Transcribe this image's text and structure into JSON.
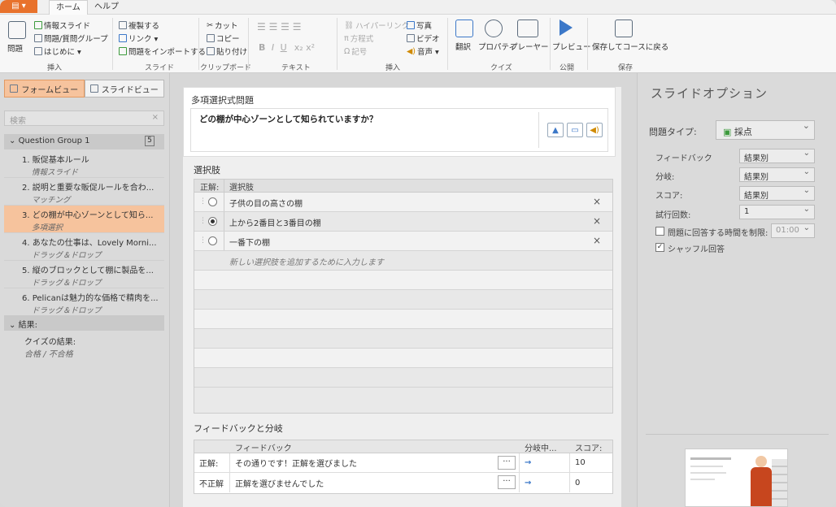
{
  "tabs": {
    "file": "▤ ▾",
    "home": "ホーム",
    "help": "ヘルプ"
  },
  "ribbon": {
    "question": "問題",
    "info_slide": "情報スライド",
    "question_group": "問題/質問グループ",
    "intro": "はじめに ▾",
    "duplicate": "複製する",
    "link": "リンク ▾",
    "import_questions": "問題をインポートする",
    "cut": "カット",
    "copy": "コピー",
    "paste": "貼り付け",
    "hyperlink": "ハイパーリンク",
    "equation": "方程式",
    "symbol": "記号",
    "photo": "写真",
    "video": "ビデオ",
    "audio": "音声 ▾",
    "translate": "翻訳",
    "properties": "プロパティ",
    "player": "プレーヤー",
    "preview": "プレビュー",
    "save_return": "保存してコースに戻る",
    "groups": {
      "insert": "挿入",
      "slides": "スライド",
      "clipboard": "クリップボード",
      "text": "テキスト",
      "insert2": "挿入",
      "quiz": "クイズ",
      "publish": "公開",
      "save": "保存"
    }
  },
  "left": {
    "form_view": "フォームビュー",
    "slide_view": "スライドビュー",
    "search_placeholder": "検索",
    "group_name": "Question Group 1",
    "group_count": "5",
    "slides": [
      {
        "title": "1. 販促基本ルール",
        "sub": "情報スライド"
      },
      {
        "title": "2. 説明と重要な販促ルールを合わ...",
        "sub": "マッチング"
      },
      {
        "title": "3. どの棚が中心ゾーンとして知ら...",
        "sub": "多項選択"
      },
      {
        "title": "4. あなたの仕事は、Lovely Morni...",
        "sub": "ドラッグ＆ドロップ"
      },
      {
        "title": "5. 縦のブロックとして棚に製品を...",
        "sub": "ドラッグ＆ドロップ"
      },
      {
        "title": "6. Pelicanは魅力的な価格で精肉を...",
        "sub": "ドラッグ＆ドロップ"
      }
    ],
    "results_header": "結果:",
    "results_title": "クイズの結果:",
    "results_sub": "合格 / 不合格"
  },
  "center": {
    "question_type": "多項選択式問題",
    "question_text": "どの棚が中心ゾーンとして知られていますか？",
    "choices_title": "選択肢",
    "col_correct": "正解:",
    "col_choice": "選択肢",
    "choices": [
      {
        "text": "子供の目の高さの棚",
        "correct": false
      },
      {
        "text": "上から2番目と3番目の棚",
        "correct": true
      },
      {
        "text": "一番下の棚",
        "correct": false
      }
    ],
    "add_placeholder": "新しい選択肢を追加するために入力します",
    "feedback_title": "フィードバックと分岐",
    "fb_col_feedback": "フィードバック",
    "fb_col_branch": "分岐中...",
    "fb_col_score": "スコア:",
    "fb_rows": [
      {
        "label": "正解:",
        "text": "その通りです！正解を選びました",
        "score": "10"
      },
      {
        "label": "不正解",
        "text": "正解を選びませんでした",
        "score": "0"
      }
    ]
  },
  "right": {
    "title": "スライドオプション",
    "question_type_label": "問題タイプ:",
    "question_type_value": "採点",
    "feedback_label": "フィードバック",
    "feedback_value": "結果別",
    "branch_label": "分岐:",
    "branch_value": "結果別",
    "score_label": "スコア:",
    "score_value": "結果別",
    "attempts_label": "試行回数:",
    "attempts_value": "1",
    "time_limit_label": "問題に回答する時間を制限:",
    "time_limit_value": "01:00",
    "shuffle_label": "シャッフル回答"
  },
  "colors": {
    "accent": "#e8722c",
    "selected": "#f6c39d",
    "link": "#3c78c8"
  }
}
